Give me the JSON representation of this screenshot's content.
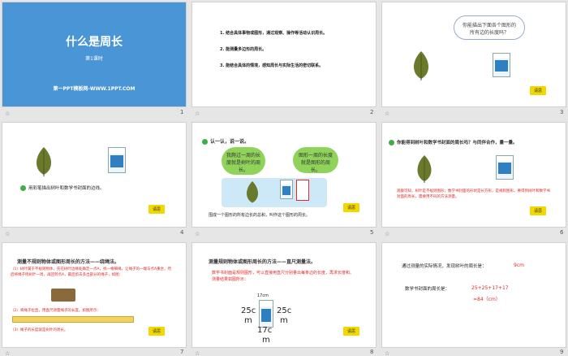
{
  "slide1": {
    "title": "什么是周长",
    "subtitle": "第1课时",
    "footer": "第一PPT模板网-WWW.1PPT.COM",
    "number": "1"
  },
  "slide2": {
    "items": [
      "1. 结合具体事物或图形，通过观察、操作等活动认识周长。",
      "2. 能测量多边形的周长。",
      "3. 能结合具体的情境，感知周长与实际生活的密切联系。"
    ],
    "number": "2"
  },
  "slide3": {
    "question": "你能描出下面各个图形的所有边的长度吗？",
    "reply": "请思",
    "number": "3"
  },
  "slide4": {
    "text": "用彩笔描出树叶和数学书封面的边线。",
    "reply": "请思",
    "number": "4"
  },
  "slide5": {
    "heading": "认一认，说一说。",
    "cloud1": "我爬过一周的长度就是树叶的周长。",
    "cloud2": "图形一周的长度就是图形的周长。",
    "caption": "围成一个图形的所有边长的总和，叫作这个图形的周长。",
    "reply": "请思",
    "number": "5"
  },
  "slide6": {
    "heading": "你能得到树叶和数学书封面的周长吗？与同伴合作，量一量。",
    "text": "观察可知，树叶是不规则图形；数学书封面的形状是长方形，是规则图形。要得到树叶和数学书封面的周长，需要用不同的方法测量。",
    "reply": "请思",
    "number": "6"
  },
  "slide7": {
    "heading": "测量不规则物体或图形周长的方法——绕绳法。",
    "steps": [
      "（1）树叶属于不规则物体，先在树叶边缘处确定一点A，找一根细绳，让绳子的一端与点A重合，然后将绳子绕树叶一周，再回到点A，最后剪去多出部分的绳子，如图：",
      "（2）将绳子拉直，用直尺测量绳子的长度。如图所示：",
      "（3）绳子的长度就是树叶的周长。"
    ],
    "reply": "请思",
    "number": "7"
  },
  "slide8": {
    "heading": "测量规则物体或图形周长的方法——直尺测量法。",
    "text": "数学书封面是规则图形，可以直接用直尺分别量出每条边的长度，再求长度和。测量结果如图所示：",
    "labels": {
      "top": "17cm",
      "left_a": "25c",
      "left_b": "m",
      "right_a": "25c",
      "right_b": "m",
      "bottom_a": "17c",
      "bottom_b": "m"
    },
    "reply": "请思",
    "number": "8"
  },
  "slide9": {
    "line1_label": "通过测量的实际情况，发现树叶的周长是：",
    "line1_value": "9cm",
    "line2_label": "数学书封面的周长是：",
    "line2_value": "25+25+17+17",
    "line3_value": "=84（cm）",
    "number": "9"
  },
  "colors": {
    "title_bg": "#4a95d6",
    "green": "#3fae49",
    "red": "#e02828",
    "yellow": "#f1d800"
  }
}
